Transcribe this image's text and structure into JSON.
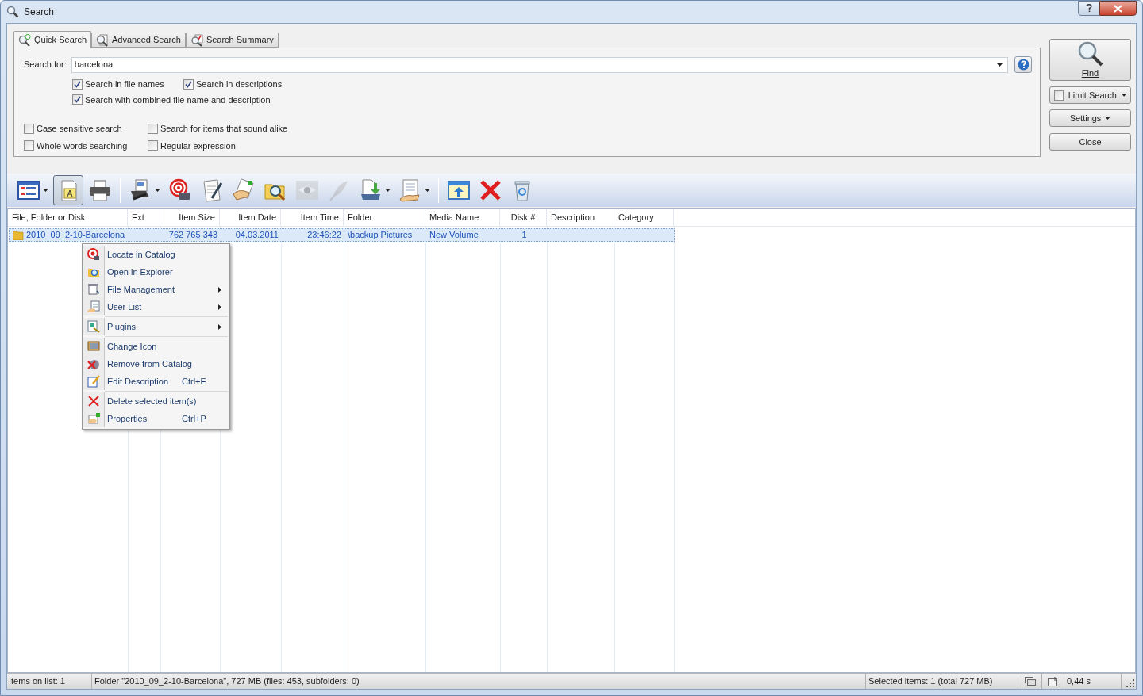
{
  "window": {
    "title": "Search"
  },
  "tabs": [
    {
      "label": "Quick Search",
      "selected": true
    },
    {
      "label": "Advanced Search",
      "selected": false
    },
    {
      "label": "Search Summary",
      "selected": false
    }
  ],
  "search": {
    "label": "Search for:",
    "value": "barcelona"
  },
  "options": [
    [
      {
        "label": "Search in file names",
        "checked": true
      },
      {
        "label": "Search in descriptions",
        "checked": true
      }
    ],
    [
      {
        "label": "Search with combined file name and description",
        "checked": true
      }
    ]
  ],
  "extra_options": [
    {
      "label": "Case sensitive search",
      "checked": false
    },
    {
      "label": "Search for items that sound alike",
      "checked": false
    },
    {
      "label": "Whole words searching",
      "checked": false
    },
    {
      "label": "Regular expression",
      "checked": false
    }
  ],
  "buttons": {
    "find": "Find",
    "limit_search": {
      "label": "Limit Search",
      "checked": false
    },
    "settings": "Settings",
    "close": "Close"
  },
  "toolbar": [
    {
      "kind": "list",
      "pressed": false,
      "dropdown": true,
      "disabled": false
    },
    {
      "kind": "note",
      "pressed": true,
      "dropdown": false,
      "disabled": false
    },
    {
      "kind": "print",
      "pressed": false,
      "dropdown": false,
      "disabled": false
    },
    {
      "kind": "separator"
    },
    {
      "kind": "export",
      "pressed": false,
      "dropdown": true,
      "disabled": false
    },
    {
      "kind": "target",
      "pressed": false,
      "dropdown": false,
      "disabled": false
    },
    {
      "kind": "edit",
      "pressed": false,
      "dropdown": false,
      "disabled": false
    },
    {
      "kind": "hand",
      "pressed": false,
      "dropdown": false,
      "disabled": false
    },
    {
      "kind": "folder-search",
      "pressed": false,
      "dropdown": false,
      "disabled": false
    },
    {
      "kind": "eye",
      "pressed": false,
      "dropdown": false,
      "disabled": true
    },
    {
      "kind": "feather",
      "pressed": false,
      "dropdown": false,
      "disabled": true
    },
    {
      "kind": "download",
      "pressed": false,
      "dropdown": true,
      "disabled": false
    },
    {
      "kind": "notes",
      "pressed": false,
      "dropdown": true,
      "disabled": false
    },
    {
      "kind": "separator"
    },
    {
      "kind": "window-up",
      "pressed": false,
      "dropdown": false,
      "disabled": false
    },
    {
      "kind": "delete",
      "pressed": false,
      "dropdown": false,
      "disabled": false
    },
    {
      "kind": "recycle",
      "pressed": false,
      "dropdown": false,
      "disabled": false
    }
  ],
  "table": {
    "columns": [
      "File, Folder or Disk",
      "Ext",
      "Item Size",
      "Item Date",
      "Item Time",
      "Folder",
      "Media Name",
      "Disk #",
      "Description",
      "Category"
    ],
    "rows": [
      {
        "name": "2010_09_2-10-Barcelona",
        "size": "762 765 343",
        "date": "04.03.2011",
        "time": "23:46:22",
        "folder": "\\backup Pictures",
        "media": "New Volume",
        "disk": "1",
        "selected": true
      }
    ]
  },
  "context_menu": [
    {
      "kind": "item",
      "label": "Locate in Catalog",
      "submenu": false
    },
    {
      "kind": "item",
      "label": "Open in Explorer",
      "submenu": false
    },
    {
      "kind": "item",
      "label": "File Management",
      "submenu": true
    },
    {
      "kind": "item",
      "label": "User List",
      "submenu": true
    },
    {
      "kind": "separator"
    },
    {
      "kind": "item",
      "label": "Plugins",
      "submenu": true
    },
    {
      "kind": "separator"
    },
    {
      "kind": "item",
      "label": "Change Icon",
      "submenu": false
    },
    {
      "kind": "item",
      "label": "Remove from Catalog",
      "submenu": false
    },
    {
      "kind": "item",
      "label": "Edit Description",
      "shortcut": "Ctrl+E",
      "submenu": false
    },
    {
      "kind": "separator"
    },
    {
      "kind": "item",
      "label": "Delete selected item(s)",
      "submenu": false
    },
    {
      "kind": "item",
      "label": "Properties",
      "shortcut": "Ctrl+P",
      "submenu": false
    }
  ],
  "status_bar": {
    "items": "Items on list: 1",
    "info": "Folder \"2010_09_2-10-Barcelona\", 727 MB (files: 453, subfolders: 0)",
    "selected": "Selected items: 1 (total 727 MB)",
    "time": "0,44 s"
  }
}
